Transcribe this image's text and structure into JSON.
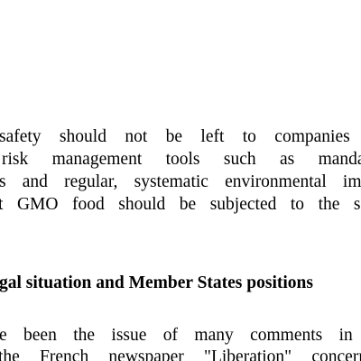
{
  "paragraph_1": {
    "lines": [
      "safety should not be left to companies but",
      "risk management tools such as mandatory",
      "s and regular, systematic environmental impact",
      "t GMO food should be subjected to the same"
    ]
  },
  "section_heading": "gal situation and Member States positions",
  "paragraph_2": {
    "lines": [
      "e been the issue of many comments in the",
      "the French newspaper \"Liberation\" concerning"
    ]
  }
}
